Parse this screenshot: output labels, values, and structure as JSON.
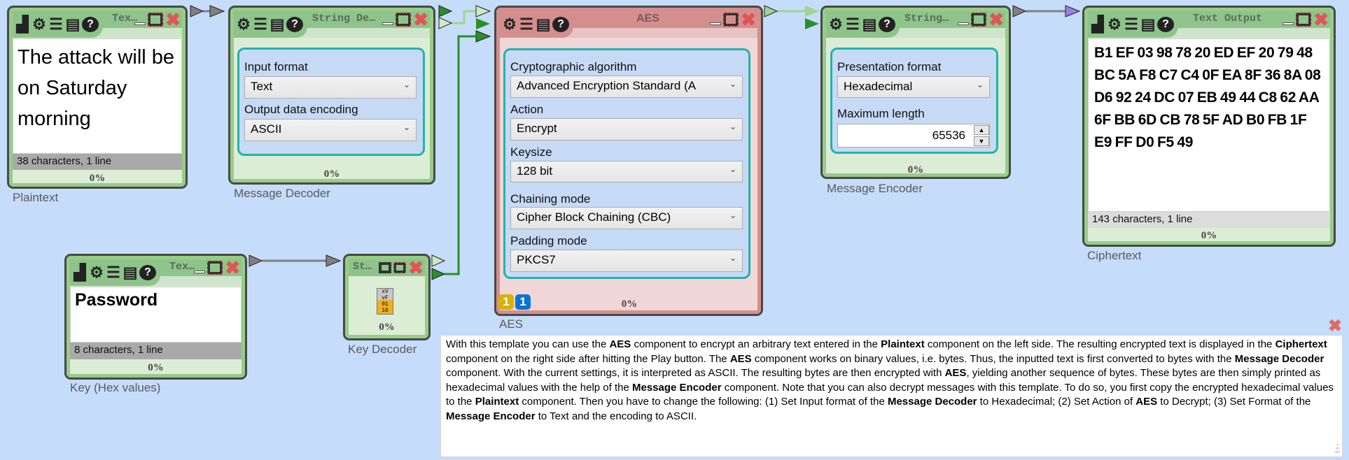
{
  "colors": {
    "canvas": "#c6dcfb",
    "node_green": "#98cc89",
    "node_pink": "#d48e8e",
    "settings_border": "#22b3aa",
    "wire_green": "#2a8f2a",
    "wire_light": "#9fd58f",
    "wire_gray": "#808080",
    "input_purple": "#9a7ee6"
  },
  "plaintext": {
    "title": "Tex…",
    "text": "The attack will be on Saturday morning",
    "status": "38 characters,  1 line",
    "progress": "0%",
    "label": "Plaintext",
    "icons": [
      "image-icon",
      "gear-icon",
      "list-icon",
      "clipboard-icon",
      "help-icon"
    ]
  },
  "message_decoder": {
    "title": "String De…",
    "input_format_label": "Input format",
    "input_format": "Text",
    "encoding_label": "Output data encoding",
    "encoding": "ASCII",
    "progress": "0%",
    "label": "Message Decoder"
  },
  "aes": {
    "title": "AES",
    "algorithm_label": "Cryptographic algorithm",
    "algorithm": "Advanced Encryption Standard (A",
    "action_label": "Action",
    "action": "Encrypt",
    "keysize_label": "Keysize",
    "keysize": "128 bit",
    "chaining_label": "Chaining mode",
    "chaining": "Cipher Block Chaining (CBC)",
    "padding_label": "Padding mode",
    "padding": "PKCS7",
    "badge_yellow": "1",
    "badge_blue": "1",
    "progress": "0%",
    "label": "AES"
  },
  "message_encoder": {
    "title": "String…",
    "format_label": "Presentation format",
    "format": "Hexadecimal",
    "maxlen_label": "Maximum length",
    "maxlen": "65536",
    "progress": "0%",
    "label": "Message Encoder"
  },
  "text_output": {
    "title": "Text Output",
    "text": "B1 EF 03 98 78 20 ED EF 20 79 48 BC 5A F8 C7 C4 0F EA 8F 36 8A 08 D6 92 24 DC 07 EB 49 44 C8 62 AA 6F BB 6D CB 78 5F AD B0 FB 1F E9 FF D0 F5 49",
    "status": "143 characters,  1 line",
    "progress": "0%",
    "label": "Ciphertext"
  },
  "key": {
    "title": "Tex…",
    "text": "Password",
    "status": "8 characters,  1 line",
    "progress": "0%",
    "label": "Key (Hex values)"
  },
  "key_decoder": {
    "title": "St…",
    "progress": "0%",
    "label": "Key Decoder"
  },
  "description": {
    "segments": [
      {
        "t": "With this template you can use the "
      },
      {
        "t": "AES",
        "b": true
      },
      {
        "t": " component to encrypt an arbitrary text entered in the "
      },
      {
        "t": "Plaintext",
        "b": true
      },
      {
        "t": " component on the left side. The resulting encrypted text is displayed in the "
      },
      {
        "t": "Ciphertext",
        "b": true
      },
      {
        "t": " component on the right side after hitting the Play button. The "
      },
      {
        "t": "AES",
        "b": true
      },
      {
        "t": " component works on binary values, i.e. bytes. Thus, the inputted text is first converted to bytes with the "
      },
      {
        "t": "Message Decoder",
        "b": true
      },
      {
        "t": " component. With the current settings, it is interpreted as ASCII. The resulting bytes are then encrypted with "
      },
      {
        "t": "AES",
        "b": true
      },
      {
        "t": ", yielding another sequence of bytes. These bytes are then simply printed as hexadecimal values with the help of the "
      },
      {
        "t": "Message Encoder",
        "b": true
      },
      {
        "t": " component. Note that you can also decrypt messages with this template. To do so, you first copy the encrypted hexadecimal values to the "
      },
      {
        "t": "Plaintext",
        "b": true
      },
      {
        "t": " component. Then you have to change the following: (1) Set Input format of the "
      },
      {
        "t": "Message Decoder",
        "b": true
      },
      {
        "t": " to Hexadecimal; (2) Set Action of "
      },
      {
        "t": "AES",
        "b": true
      },
      {
        "t": " to Decrypt; (3) Set Format of the "
      },
      {
        "t": "Message Encoder",
        "b": true
      },
      {
        "t": " to Text and the encoding to ASCII."
      }
    ]
  }
}
